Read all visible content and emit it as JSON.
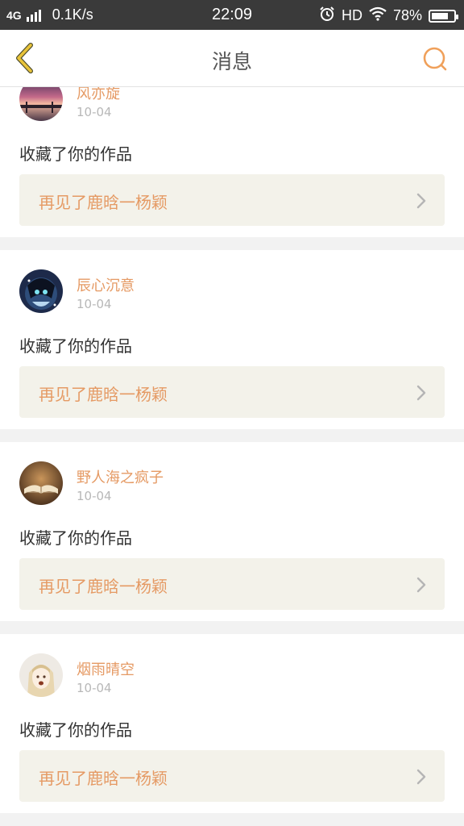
{
  "status_bar": {
    "network": "4G",
    "speed": "0.1K/s",
    "time": "22:09",
    "hd": "HD",
    "battery": "78%",
    "battery_level": 0.78
  },
  "header": {
    "title": "消息",
    "accent_color": "#e8b93a"
  },
  "messages": [
    {
      "username": "风亦旋",
      "date": "10-04",
      "action": "收藏了你的作品",
      "work_title": "再见了鹿晗一杨颖"
    },
    {
      "username": "辰心沉意",
      "date": "10-04",
      "action": "收藏了你的作品",
      "work_title": "再见了鹿晗一杨颖"
    },
    {
      "username": "野人海之疯子",
      "date": "10-04",
      "action": "收藏了你的作品",
      "work_title": "再见了鹿晗一杨颖"
    },
    {
      "username": "烟雨晴空",
      "date": "10-04",
      "action": "收藏了你的作品",
      "work_title": "再见了鹿晗一杨颖"
    }
  ],
  "colors": {
    "username": "#e59a64",
    "work_title": "#e59a64",
    "search_icon": "#f0a05a",
    "back_icon": "#e8c33a"
  }
}
